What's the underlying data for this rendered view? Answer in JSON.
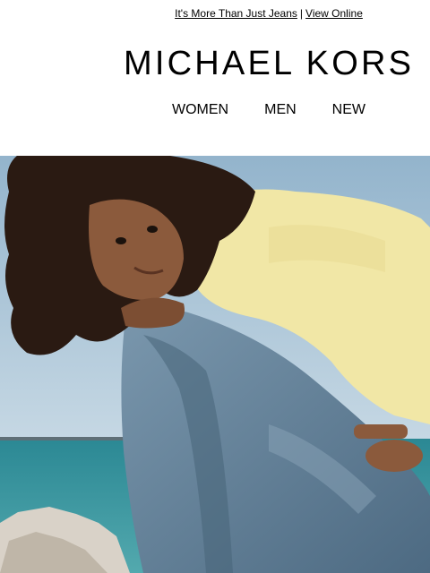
{
  "preheader": {
    "tagline_link": "It's More Than Just Jeans",
    "separator": "|",
    "view_online": "View Online"
  },
  "brand": {
    "logo_text": "MICHAEL KORS"
  },
  "nav": {
    "items": [
      "WOMEN",
      "MEN",
      "NEW"
    ]
  },
  "colors": {
    "sky": "#a9c3d6",
    "sea": "#2f8f9c",
    "sweater": "#f1e7a6",
    "denim": "#5f7f98",
    "hair": "#2a1a12",
    "skin": "#8b5a3c"
  }
}
